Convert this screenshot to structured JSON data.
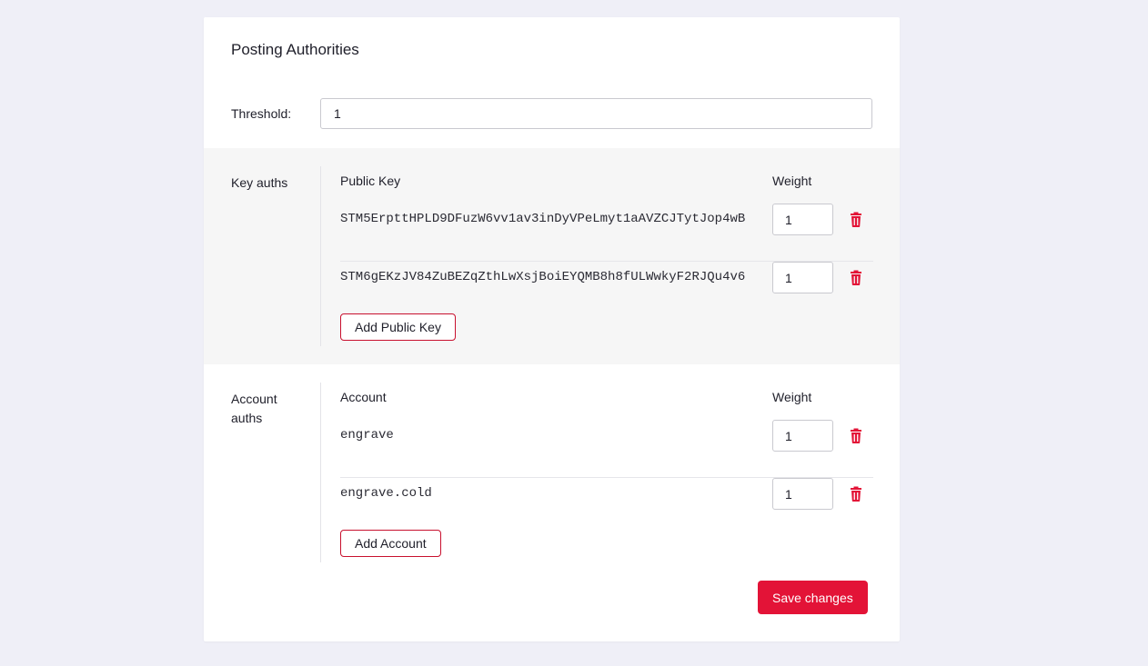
{
  "title": "Posting Authorities",
  "threshold": {
    "label": "Threshold:",
    "value": "1"
  },
  "key_auths": {
    "label": "Key auths",
    "column_key": "Public Key",
    "column_weight": "Weight",
    "rows": [
      {
        "key": "STM5ErpttHPLD9DFuzW6vv1av3inDyVPeLmyt1aAVZCJTytJop4wB",
        "weight": "1"
      },
      {
        "key": "STM6gEKzJV84ZuBEZqZthLwXsjBoiEYQMB8h8fULWwkyF2RJQu4v6",
        "weight": "1"
      }
    ],
    "add_label": "Add Public Key"
  },
  "account_auths": {
    "label": "Account auths",
    "column_account": "Account",
    "column_weight": "Weight",
    "rows": [
      {
        "account": "engrave",
        "weight": "1"
      },
      {
        "account": "engrave.cold",
        "weight": "1"
      }
    ],
    "add_label": "Add Account"
  },
  "save_label": "Save changes",
  "colors": {
    "accent": "#e31337",
    "page_bg": "#efeff7",
    "section_bg": "#f6f6f6"
  },
  "icons": {
    "delete": "trash-icon"
  }
}
